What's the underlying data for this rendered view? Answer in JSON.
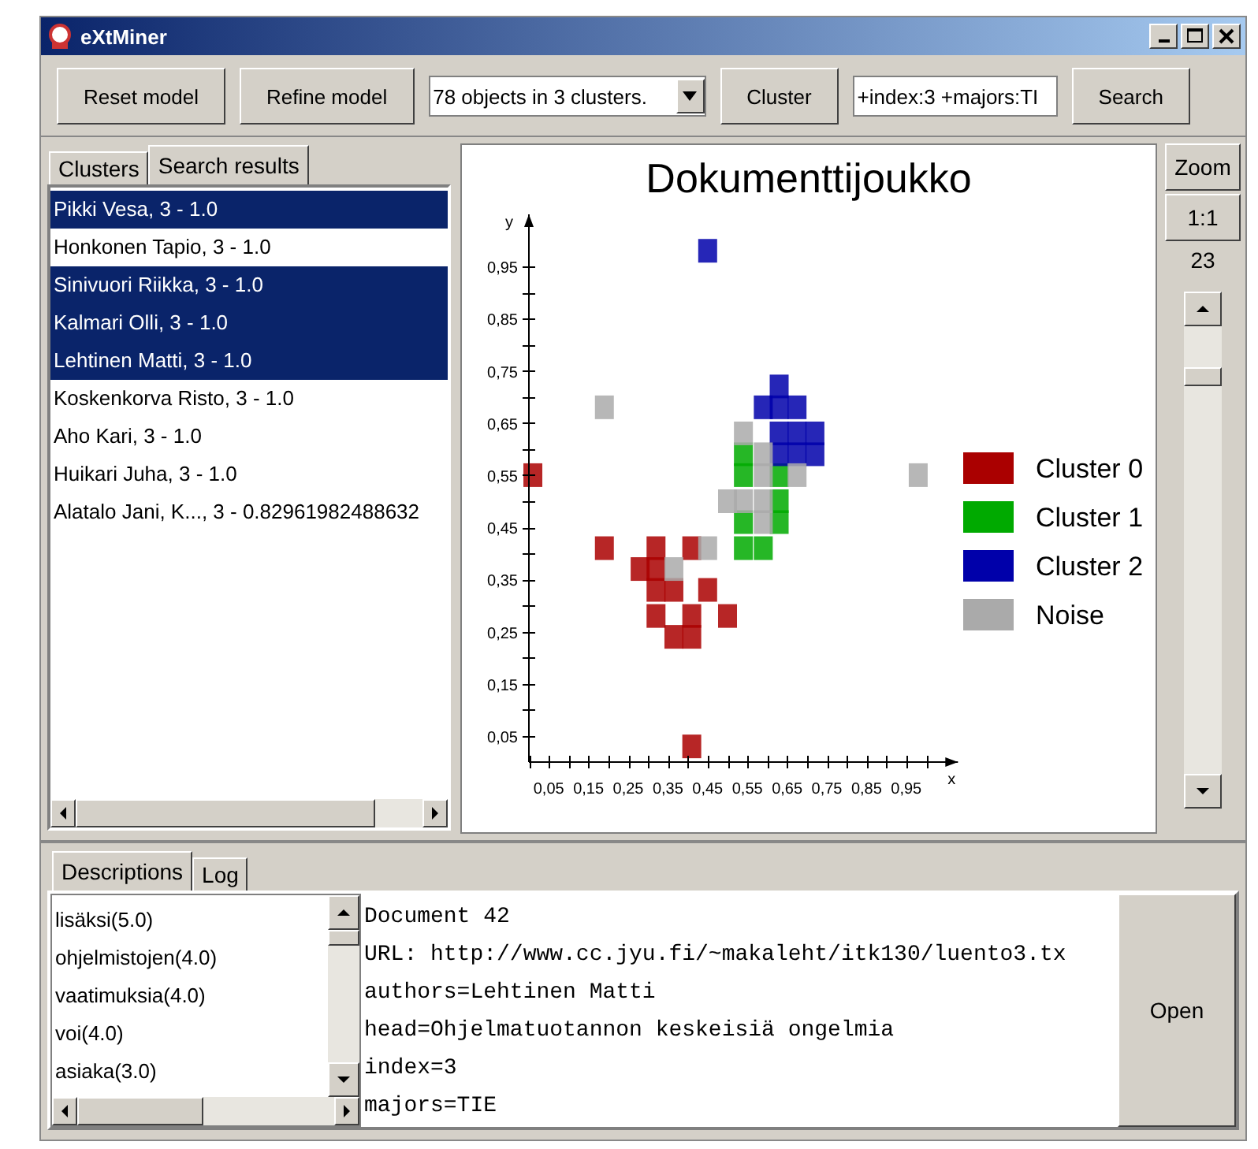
{
  "window": {
    "title": "eXtMiner"
  },
  "toolbar": [
    {
      "kind": "button",
      "label": "Reset model"
    },
    {
      "kind": "button",
      "label": "Refine model"
    },
    {
      "kind": "combo",
      "value": "78 objects in 3 clusters."
    },
    {
      "kind": "button",
      "label": "Cluster"
    },
    {
      "kind": "field",
      "value": "+index:3 +majors:TI"
    },
    {
      "kind": "button",
      "label": "Search"
    }
  ],
  "left_tabs": [
    {
      "label": "Clusters",
      "selected": false
    },
    {
      "label": "Search results",
      "selected": true
    }
  ],
  "results": [
    {
      "text": "Pikki Vesa, 3 - 1.0",
      "selected": true
    },
    {
      "text": "Honkonen Tapio, 3 - 1.0",
      "selected": false
    },
    {
      "text": "Sinivuori Riikka, 3 - 1.0",
      "selected": true
    },
    {
      "text": "Kalmari Olli, 3 - 1.0",
      "selected": true
    },
    {
      "text": "Lehtinen Matti, 3 - 1.0",
      "selected": true
    },
    {
      "text": "Koskenkorva Risto, 3 - 1.0",
      "selected": false
    },
    {
      "text": "Aho Kari, 3 - 1.0",
      "selected": false
    },
    {
      "text": "Huikari Juha, 3 - 1.0",
      "selected": false
    },
    {
      "text": "Alatalo Jani, K..., 3 - 0.82961982488632",
      "selected": false
    }
  ],
  "chart": {
    "chart_data": {
      "type": "scatter",
      "title": "Dokumenttijoukko",
      "xlabel": "x",
      "ylabel": "y",
      "xlim": [
        0,
        1.08
      ],
      "ylim": [
        0,
        1.05
      ],
      "legend": "right",
      "xticks": [
        {
          "value": 0.05,
          "label": "0,05"
        },
        {
          "value": 0.15,
          "label": "0,15"
        },
        {
          "value": 0.25,
          "label": "0,25"
        },
        {
          "value": 0.35,
          "label": "0,35"
        },
        {
          "value": 0.45,
          "label": "0,45"
        },
        {
          "value": 0.55,
          "label": "0,55"
        },
        {
          "value": 0.65,
          "label": "0,65"
        },
        {
          "value": 0.75,
          "label": "0,75"
        },
        {
          "value": 0.85,
          "label": "0,85"
        },
        {
          "value": 0.95,
          "label": "0,95"
        }
      ],
      "yticks": [
        {
          "value": 0.05,
          "label": "0,05"
        },
        {
          "value": 0.15,
          "label": "0,15"
        },
        {
          "value": 0.25,
          "label": "0,25"
        },
        {
          "value": 0.35,
          "label": "0,35"
        },
        {
          "value": 0.45,
          "label": "0,45"
        },
        {
          "value": 0.55,
          "label": "0,55"
        },
        {
          "value": 0.65,
          "label": "0,65"
        },
        {
          "value": 0.75,
          "label": "0,75"
        },
        {
          "value": 0.85,
          "label": "0,85"
        },
        {
          "value": 0.95,
          "label": "0,95"
        }
      ],
      "series": [
        {
          "name": "Cluster 0",
          "color": "#aa0000",
          "x": [
            0.01,
            0.19,
            0.32,
            0.41,
            0.28,
            0.32,
            0.32,
            0.365,
            0.45,
            0.32,
            0.41,
            0.5,
            0.365,
            0.41,
            0.41
          ],
          "values": [
            0.55,
            0.41,
            0.41,
            0.41,
            0.37,
            0.37,
            0.33,
            0.33,
            0.33,
            0.28,
            0.28,
            0.28,
            0.24,
            0.24,
            0.03
          ]
        },
        {
          "name": "Cluster 1",
          "color": "#00aa00",
          "x": [
            0.54,
            0.54,
            0.63,
            0.63,
            0.54,
            0.63,
            0.54,
            0.59
          ],
          "values": [
            0.59,
            0.55,
            0.55,
            0.5,
            0.46,
            0.46,
            0.41,
            0.41
          ]
        },
        {
          "name": "Cluster 2",
          "color": "#0000aa",
          "x": [
            0.45,
            0.63,
            0.59,
            0.63,
            0.675,
            0.63,
            0.675,
            0.72,
            0.63,
            0.675,
            0.72
          ],
          "values": [
            0.98,
            0.72,
            0.68,
            0.68,
            0.68,
            0.63,
            0.63,
            0.63,
            0.59,
            0.59,
            0.59
          ]
        },
        {
          "name": "Noise",
          "color": "#aaaaaa",
          "x": [
            0.19,
            0.54,
            0.59,
            0.59,
            0.675,
            0.98,
            0.5,
            0.54,
            0.59,
            0.59,
            0.45,
            0.365
          ],
          "values": [
            0.68,
            0.63,
            0.59,
            0.55,
            0.55,
            0.55,
            0.5,
            0.5,
            0.5,
            0.46,
            0.41,
            0.37
          ]
        }
      ]
    }
  },
  "zoom_panel": {
    "zoom_button": "Zoom",
    "reset_button": "1:1",
    "zoom_value": "23"
  },
  "bottom_tabs": [
    {
      "label": "Descriptions",
      "selected": true
    },
    {
      "label": "Log",
      "selected": false
    }
  ],
  "keywords": [
    "lisäksi(5.0)",
    "ohjelmistojen(4.0)",
    "vaatimuksia(4.0)",
    "voi(4.0)",
    "asiaka(3.0)"
  ],
  "description_lines": [
    "Document 42",
    "URL: http://www.cc.jyu.fi/~makaleht/itk130/luento3.tx",
    "authors=Lehtinen Matti",
    "head=Ohjelmatuotannon keskeisiä ongelmia",
    "index=3",
    "majors=TIE"
  ],
  "open_button": "Open"
}
